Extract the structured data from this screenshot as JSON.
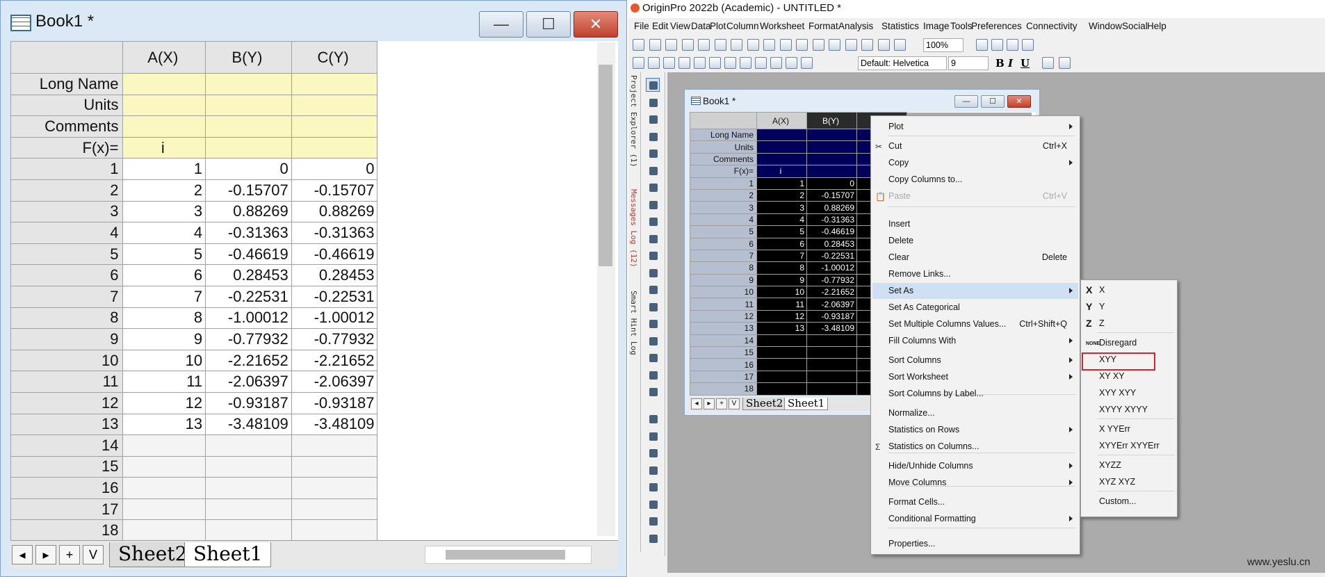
{
  "left_book": {
    "title": "Book1 *",
    "buttons": {
      "minimize": "—",
      "maximize": "☐",
      "close": "✕"
    },
    "columns": [
      "A(X)",
      "B(Y)",
      "C(Y)"
    ],
    "meta_rows": [
      "Long Name",
      "Units",
      "Comments",
      "F(x)="
    ],
    "fx_value": "i",
    "rows": [
      {
        "n": "1",
        "a": "1",
        "b": "0",
        "c": "0"
      },
      {
        "n": "2",
        "a": "2",
        "b": "-0.15707",
        "c": "-0.15707"
      },
      {
        "n": "3",
        "a": "3",
        "b": "0.88269",
        "c": "0.88269"
      },
      {
        "n": "4",
        "a": "4",
        "b": "-0.31363",
        "c": "-0.31363"
      },
      {
        "n": "5",
        "a": "5",
        "b": "-0.46619",
        "c": "-0.46619"
      },
      {
        "n": "6",
        "a": "6",
        "b": "0.28453",
        "c": "0.28453"
      },
      {
        "n": "7",
        "a": "7",
        "b": "-0.22531",
        "c": "-0.22531"
      },
      {
        "n": "8",
        "a": "8",
        "b": "-1.00012",
        "c": "-1.00012"
      },
      {
        "n": "9",
        "a": "9",
        "b": "-0.77932",
        "c": "-0.77932"
      },
      {
        "n": "10",
        "a": "10",
        "b": "-2.21652",
        "c": "-2.21652"
      },
      {
        "n": "11",
        "a": "11",
        "b": "-2.06397",
        "c": "-2.06397"
      },
      {
        "n": "12",
        "a": "12",
        "b": "-0.93187",
        "c": "-0.93187"
      },
      {
        "n": "13",
        "a": "13",
        "b": "-3.48109",
        "c": "-3.48109"
      }
    ],
    "empty_rows": [
      "14",
      "15",
      "16",
      "17",
      "18"
    ],
    "tab_nav": [
      "◂",
      "▸",
      "+",
      "V"
    ],
    "sheets": [
      "Sheet2",
      "Sheet1"
    ],
    "active_sheet": "Sheet1"
  },
  "app": {
    "title": "OriginPro 2022b (Academic) - UNTITLED *",
    "menu": [
      "File",
      "Edit",
      "View",
      "Data",
      "Plot",
      "Column",
      "Worksheet",
      "Format",
      "Analysis",
      "Statistics",
      "Image",
      "Tools",
      "Preferences",
      "Connectivity",
      "Window",
      "Social",
      "Help"
    ],
    "zoom": "100%",
    "font": "Default: Helvetica",
    "font_size": "9",
    "format_buttons": [
      "B",
      "I",
      "U"
    ],
    "side_tabs": [
      "Project Explorer (1)",
      "Messages Log (12)",
      "Smart Hint Log"
    ]
  },
  "inner_book": {
    "title": "Book1 *",
    "columns": [
      "A(X)",
      "B(Y)"
    ],
    "meta_rows": [
      "Long Name",
      "Units",
      "Comments",
      "F(x)="
    ],
    "fx_value": "i",
    "row_numbers": [
      "1",
      "2",
      "3",
      "4",
      "5",
      "6",
      "7",
      "8",
      "9",
      "10",
      "11",
      "12",
      "13",
      "14",
      "15",
      "16",
      "17",
      "18"
    ],
    "a_values": [
      "1",
      "2",
      "3",
      "4",
      "5",
      "6",
      "7",
      "8",
      "9",
      "10",
      "11",
      "12",
      "13"
    ],
    "b_values": [
      "0",
      "-0.15707",
      "0.88269",
      "-0.31363",
      "-0.46619",
      "0.28453",
      "-0.22531",
      "-1.00012",
      "-0.77932",
      "-2.21652",
      "-2.06397",
      "-0.93187",
      "-3.48109"
    ],
    "sheets": [
      "Sheet2",
      "Sheet1"
    ]
  },
  "context_menu": {
    "items": [
      {
        "label": "Plot",
        "shortcut": "",
        "submenu": true
      },
      {
        "label": "Cut",
        "shortcut": "Ctrl+X",
        "icon": "scissors-icon"
      },
      {
        "label": "Copy",
        "shortcut": "",
        "submenu": true
      },
      {
        "label": "Copy Columns to...",
        "shortcut": ""
      },
      {
        "label": "Paste",
        "shortcut": "Ctrl+V",
        "disabled": true,
        "icon": "paste-icon"
      },
      {
        "label": "Insert",
        "shortcut": ""
      },
      {
        "label": "Delete",
        "shortcut": ""
      },
      {
        "label": "Clear",
        "shortcut": "Delete"
      },
      {
        "label": "Remove Links...",
        "shortcut": ""
      },
      {
        "label": "Set As",
        "shortcut": "",
        "submenu": true,
        "highlighted": true
      },
      {
        "label": "Set As Categorical",
        "shortcut": ""
      },
      {
        "label": "Set Multiple Columns Values...",
        "shortcut": "Ctrl+Shift+Q"
      },
      {
        "label": "Fill Columns With",
        "shortcut": "",
        "submenu": true
      },
      {
        "label": "Sort Columns",
        "shortcut": "",
        "submenu": true
      },
      {
        "label": "Sort Worksheet",
        "shortcut": "",
        "submenu": true
      },
      {
        "label": "Sort Columns by Label...",
        "shortcut": ""
      },
      {
        "label": "Normalize...",
        "shortcut": ""
      },
      {
        "label": "Statistics on Rows",
        "shortcut": "",
        "submenu": true
      },
      {
        "label": "Statistics on Columns...",
        "shortcut": "",
        "icon": "sigma-icon"
      },
      {
        "label": "Hide/Unhide Columns",
        "shortcut": "",
        "submenu": true
      },
      {
        "label": "Move Columns",
        "shortcut": "",
        "submenu": true
      },
      {
        "label": "Format Cells...",
        "shortcut": ""
      },
      {
        "label": "Conditional Formatting",
        "shortcut": "",
        "submenu": true
      },
      {
        "label": "Properties...",
        "shortcut": ""
      }
    ]
  },
  "set_as_submenu": {
    "items": [
      {
        "glyph": "X",
        "label": "X"
      },
      {
        "glyph": "Y",
        "label": "Y"
      },
      {
        "glyph": "Z",
        "label": "Z"
      },
      {
        "glyph": "NONE",
        "label": "Disregard"
      },
      {
        "glyph": "",
        "label": "XYY",
        "outlined": true
      },
      {
        "glyph": "",
        "label": "XY XY"
      },
      {
        "glyph": "",
        "label": "XYY XYY"
      },
      {
        "glyph": "",
        "label": "XYYY XYYY"
      },
      {
        "glyph": "",
        "label": "X YYErr"
      },
      {
        "glyph": "",
        "label": "XYYErr XYYErr"
      },
      {
        "glyph": "",
        "label": "XYZZ"
      },
      {
        "glyph": "",
        "label": "XYZ XYZ"
      },
      {
        "glyph": "",
        "label": "Custom..."
      }
    ],
    "highlight_color": "#e0202a"
  },
  "watermark": "www.yeslu.cn"
}
